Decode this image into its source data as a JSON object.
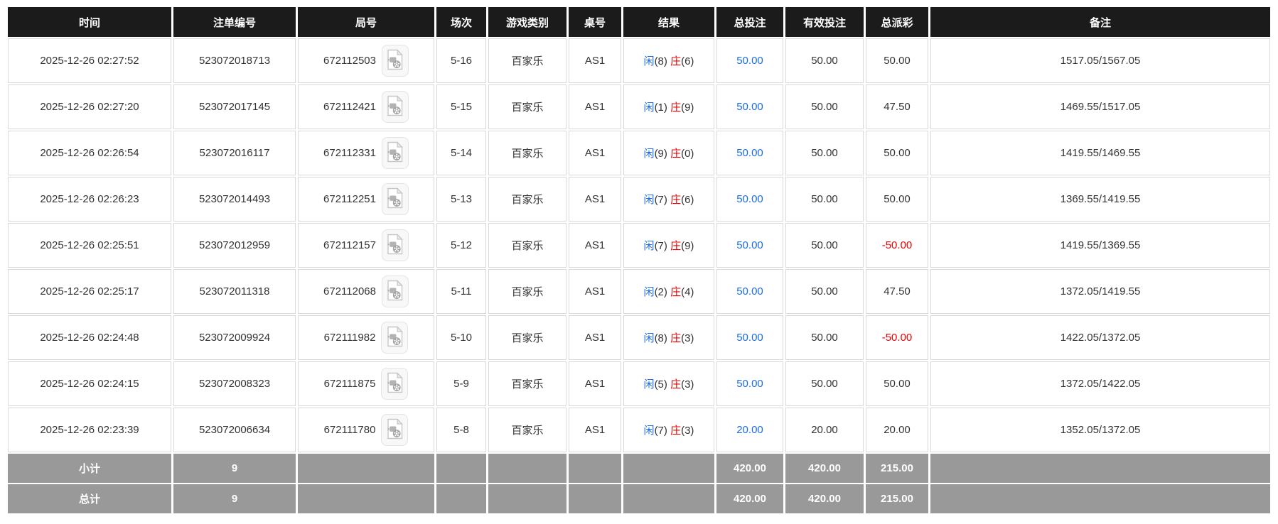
{
  "colors": {
    "header-bg": "#1b1b1b",
    "header-text": "#ffffff",
    "link-blue": "#1b6ce8",
    "player-blue": "#1b6ce8",
    "banker-red": "#e80000",
    "negative-red": "#f00000",
    "footer-bg": "#999999",
    "row-border": "#d9d9d9",
    "body-text": "#333333"
  },
  "table": {
    "columns": [
      {
        "id": "time",
        "label": "时间"
      },
      {
        "id": "bet_id",
        "label": "注单编号"
      },
      {
        "id": "round_id",
        "label": "局号"
      },
      {
        "id": "session",
        "label": "场次"
      },
      {
        "id": "game_type",
        "label": "游戏类别"
      },
      {
        "id": "table_no",
        "label": "桌号"
      },
      {
        "id": "result",
        "label": "结果"
      },
      {
        "id": "total_bet",
        "label": "总投注"
      },
      {
        "id": "valid_bet",
        "label": "有效投注"
      },
      {
        "id": "payout",
        "label": "总派彩"
      },
      {
        "id": "remark",
        "label": "备注"
      }
    ],
    "rows": [
      {
        "time": "2025-12-26 02:27:52",
        "bet_id": "523072018713",
        "round_id": "672112503",
        "session": "5-16",
        "game_type": "百家乐",
        "table_no": "AS1",
        "result": {
          "player": "闲",
          "player_score": "(8)",
          "banker": "庄",
          "banker_score": "(6)"
        },
        "total_bet": "50.00",
        "valid_bet": "50.00",
        "payout": "50.00",
        "remark": "1517.05/1567.05"
      },
      {
        "time": "2025-12-26 02:27:20",
        "bet_id": "523072017145",
        "round_id": "672112421",
        "session": "5-15",
        "game_type": "百家乐",
        "table_no": "AS1",
        "result": {
          "player": "闲",
          "player_score": "(1)",
          "banker": "庄",
          "banker_score": "(9)"
        },
        "total_bet": "50.00",
        "valid_bet": "50.00",
        "payout": "47.50",
        "remark": "1469.55/1517.05"
      },
      {
        "time": "2025-12-26 02:26:54",
        "bet_id": "523072016117",
        "round_id": "672112331",
        "session": "5-14",
        "game_type": "百家乐",
        "table_no": "AS1",
        "result": {
          "player": "闲",
          "player_score": "(9)",
          "banker": "庄",
          "banker_score": "(0)"
        },
        "total_bet": "50.00",
        "valid_bet": "50.00",
        "payout": "50.00",
        "remark": "1419.55/1469.55"
      },
      {
        "time": "2025-12-26 02:26:23",
        "bet_id": "523072014493",
        "round_id": "672112251",
        "session": "5-13",
        "game_type": "百家乐",
        "table_no": "AS1",
        "result": {
          "player": "闲",
          "player_score": "(7)",
          "banker": "庄",
          "banker_score": "(6)"
        },
        "total_bet": "50.00",
        "valid_bet": "50.00",
        "payout": "50.00",
        "remark": "1369.55/1419.55"
      },
      {
        "time": "2025-12-26 02:25:51",
        "bet_id": "523072012959",
        "round_id": "672112157",
        "session": "5-12",
        "game_type": "百家乐",
        "table_no": "AS1",
        "result": {
          "player": "闲",
          "player_score": "(7)",
          "banker": "庄",
          "banker_score": "(9)"
        },
        "total_bet": "50.00",
        "valid_bet": "50.00",
        "payout": "-50.00",
        "remark": "1419.55/1369.55"
      },
      {
        "time": "2025-12-26 02:25:17",
        "bet_id": "523072011318",
        "round_id": "672112068",
        "session": "5-11",
        "game_type": "百家乐",
        "table_no": "AS1",
        "result": {
          "player": "闲",
          "player_score": "(2)",
          "banker": "庄",
          "banker_score": "(4)"
        },
        "total_bet": "50.00",
        "valid_bet": "50.00",
        "payout": "47.50",
        "remark": "1372.05/1419.55"
      },
      {
        "time": "2025-12-26 02:24:48",
        "bet_id": "523072009924",
        "round_id": "672111982",
        "session": "5-10",
        "game_type": "百家乐",
        "table_no": "AS1",
        "result": {
          "player": "闲",
          "player_score": "(8)",
          "banker": "庄",
          "banker_score": "(3)"
        },
        "total_bet": "50.00",
        "valid_bet": "50.00",
        "payout": "-50.00",
        "remark": "1422.05/1372.05"
      },
      {
        "time": "2025-12-26 02:24:15",
        "bet_id": "523072008323",
        "round_id": "672111875",
        "session": "5-9",
        "game_type": "百家乐",
        "table_no": "AS1",
        "result": {
          "player": "闲",
          "player_score": "(5)",
          "banker": "庄",
          "banker_score": "(3)"
        },
        "total_bet": "50.00",
        "valid_bet": "50.00",
        "payout": "50.00",
        "remark": "1372.05/1422.05"
      },
      {
        "time": "2025-12-26 02:23:39",
        "bet_id": "523072006634",
        "round_id": "672111780",
        "session": "5-8",
        "game_type": "百家乐",
        "table_no": "AS1",
        "result": {
          "player": "闲",
          "player_score": "(7)",
          "banker": "庄",
          "banker_score": "(3)"
        },
        "total_bet": "20.00",
        "valid_bet": "20.00",
        "payout": "20.00",
        "remark": "1352.05/1372.05"
      }
    ],
    "footer": [
      {
        "label": "小计",
        "count": "9",
        "total_bet": "420.00",
        "valid_bet": "420.00",
        "payout": "215.00"
      },
      {
        "label": "总计",
        "count": "9",
        "total_bet": "420.00",
        "valid_bet": "420.00",
        "payout": "215.00"
      }
    ]
  }
}
